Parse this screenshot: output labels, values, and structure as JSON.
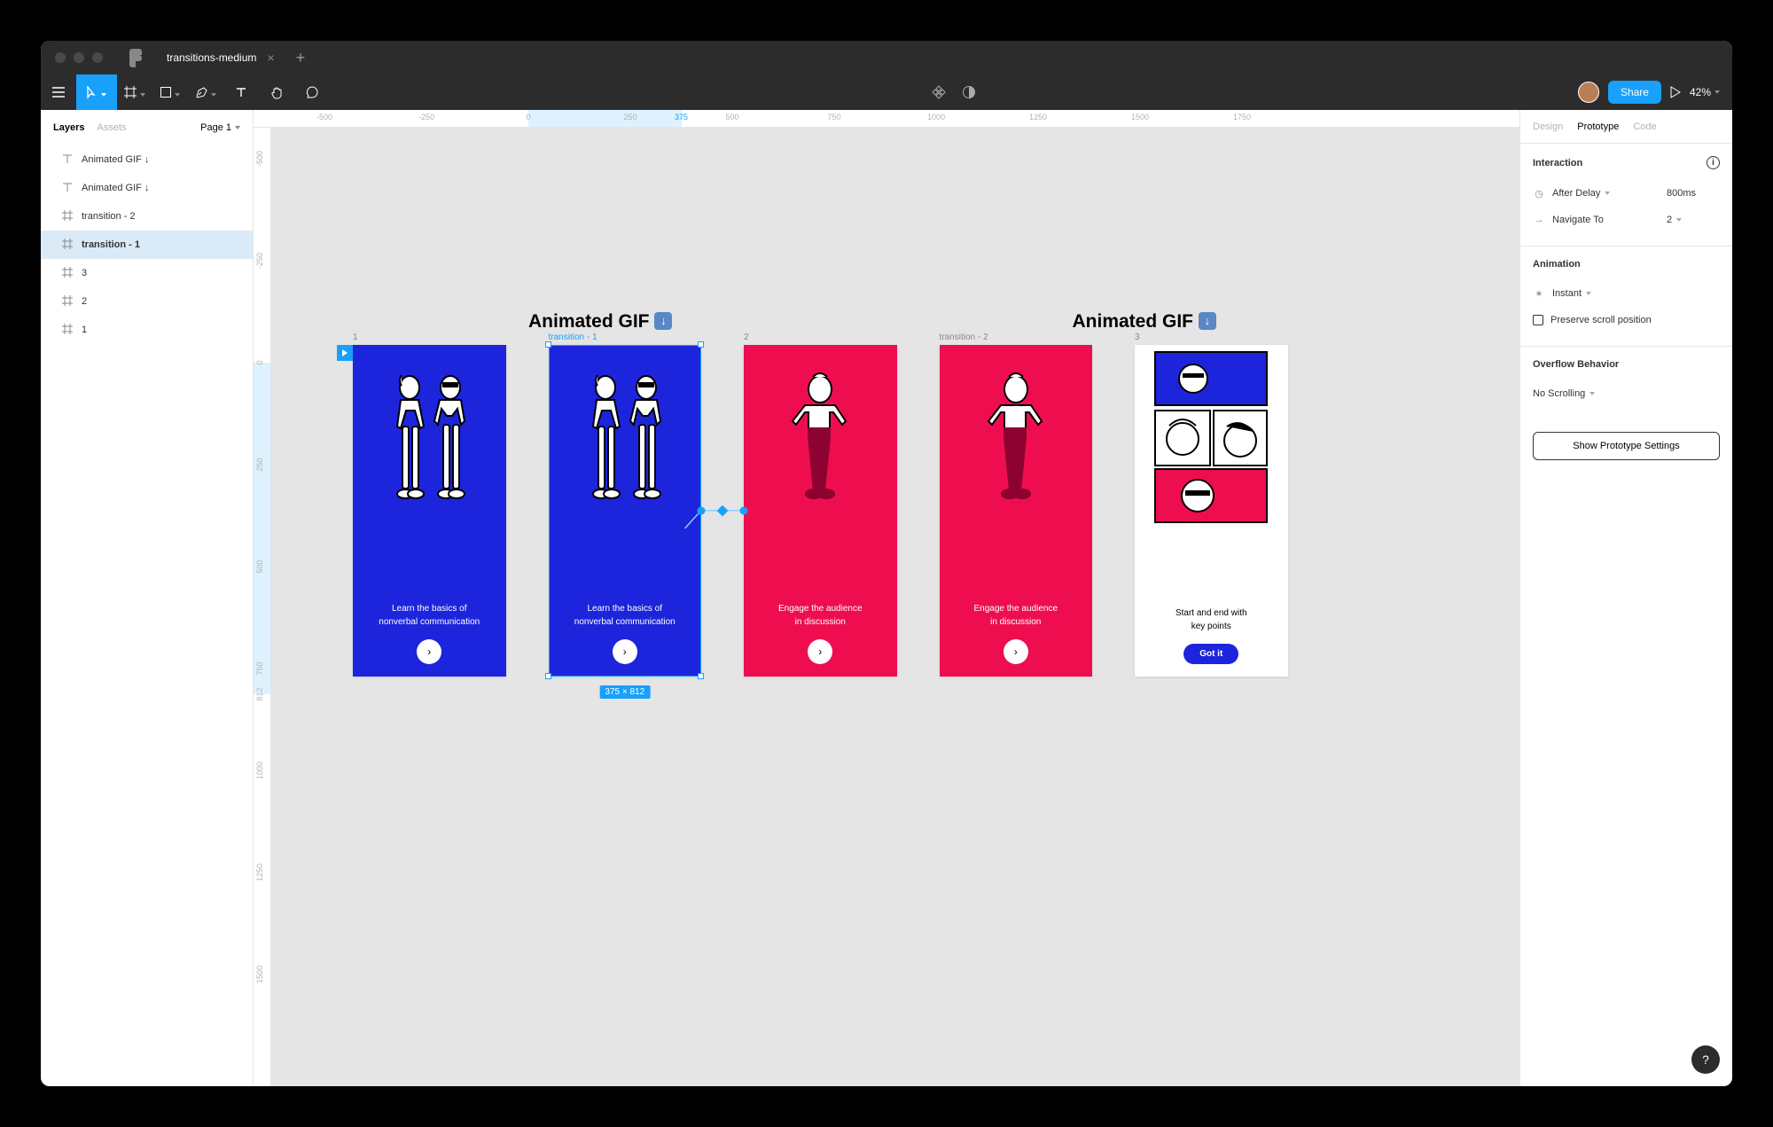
{
  "titlebar": {
    "tab_name": "transitions-medium"
  },
  "toolbar": {
    "share_label": "Share",
    "zoom": "42%"
  },
  "left_panel": {
    "layers_tab": "Layers",
    "assets_tab": "Assets",
    "page_label": "Page 1",
    "layers": [
      {
        "icon": "text",
        "label": "Animated GIF ↓"
      },
      {
        "icon": "text",
        "label": "Animated GIF ↓"
      },
      {
        "icon": "frame",
        "label": "transition - 2"
      },
      {
        "icon": "frame",
        "label": "transition - 1",
        "selected": true
      },
      {
        "icon": "frame",
        "label": "3"
      },
      {
        "icon": "frame",
        "label": "2"
      },
      {
        "icon": "frame",
        "label": "1"
      }
    ]
  },
  "ruler_h": [
    "-500",
    "-250",
    "0",
    "250",
    "375",
    "500",
    "750",
    "1000",
    "1250",
    "1500",
    "1750"
  ],
  "ruler_h_highlight": "375",
  "ruler_v": [
    "-500",
    "-250",
    "0",
    "250",
    "500",
    "750",
    "812",
    "1000",
    "1250",
    "1500"
  ],
  "ruler_v_highlight": "812",
  "canvas": {
    "title_left": "Animated GIF",
    "title_right": "Animated GIF",
    "frames": [
      {
        "name": "1",
        "bg": "blue",
        "figure": "duo",
        "line1": "Learn the basics of",
        "line2": "nonverbal communication",
        "cta": "arrow"
      },
      {
        "name": "transition - 1",
        "bg": "blue",
        "figure": "duo",
        "line1": "Learn the basics of",
        "line2": "nonverbal communication",
        "cta": "arrow",
        "selected": true
      },
      {
        "name": "2",
        "bg": "red",
        "figure": "single",
        "line1": "Engage the audience",
        "line2": "in discussion",
        "cta": "arrow"
      },
      {
        "name": "transition - 2",
        "bg": "red",
        "figure": "single",
        "line1": "Engage the audience",
        "line2": "in discussion",
        "cta": "arrow"
      },
      {
        "name": "3",
        "bg": "white",
        "figure": "grid",
        "line1": "Start and end with",
        "line2": "key points",
        "cta": "pill",
        "cta_label": "Got it"
      }
    ],
    "selection_dim": "375 × 812"
  },
  "right_panel": {
    "tabs": {
      "design": "Design",
      "prototype": "Prototype",
      "code": "Code"
    },
    "interaction": {
      "title": "Interaction",
      "trigger_label": "After Delay",
      "trigger_value": "800ms",
      "action_label": "Navigate To",
      "action_value": "2"
    },
    "animation": {
      "title": "Animation",
      "type": "Instant",
      "preserve_scroll": "Preserve scroll position"
    },
    "overflow": {
      "title": "Overflow Behavior",
      "value": "No Scrolling"
    },
    "button": "Show Prototype Settings"
  },
  "help": "?"
}
